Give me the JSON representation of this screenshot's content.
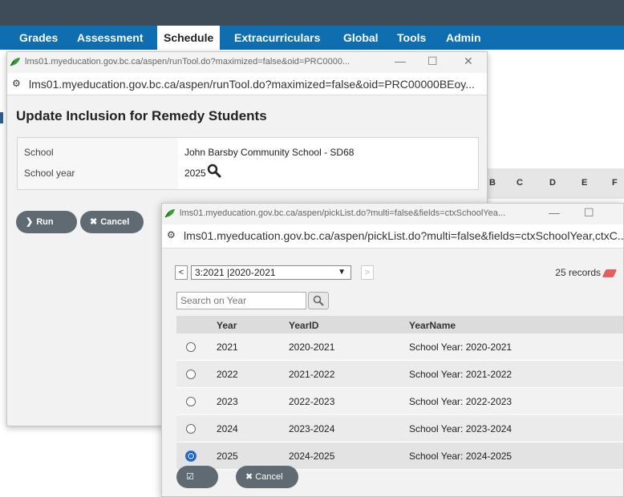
{
  "nav": {
    "tabs": [
      {
        "label": "Grades"
      },
      {
        "label": "Assessment"
      },
      {
        "label": "Schedule"
      },
      {
        "label": "Extracurriculars"
      },
      {
        "label": "Global"
      },
      {
        "label": "Tools"
      },
      {
        "label": "Admin"
      }
    ]
  },
  "background": {
    "letters": [
      "B",
      "C",
      "D",
      "E",
      "F"
    ]
  },
  "tool_window": {
    "title": "lms01.myeducation.gov.bc.ca/aspen/runTool.do?maximized=false&oid=PRC0000...",
    "url": "lms01.myeducation.gov.bc.ca/aspen/runTool.do?maximized=false&oid=PRC00000BEoy...",
    "heading": "Update Inclusion for Remedy Students",
    "fields": {
      "school_label": "School",
      "school_value": "John Barsby Community School - SD68",
      "year_label": "School year",
      "year_value": "2025"
    },
    "run_label": "Run",
    "cancel_label": "Cancel"
  },
  "picklist_window": {
    "title": "lms01.myeducation.gov.bc.ca/aspen/pickList.do?multi=false&fields=ctxSchoolYea...",
    "url": "lms01.myeducation.gov.bc.ca/aspen/pickList.do?multi=false&fields=ctxSchoolYear,ctxC...",
    "prev_label": "<",
    "next_label": ">",
    "page_select": "3:2021 |2020-2021",
    "records": "25 records",
    "search_placeholder": "Search on Year",
    "columns": [
      "Year",
      "YearID",
      "YearName"
    ],
    "rows": [
      {
        "year": "2021",
        "yearid": "2020-2021",
        "yearname": "School Year: 2020-2021",
        "selected": false
      },
      {
        "year": "2022",
        "yearid": "2021-2022",
        "yearname": "School Year: 2021-2022",
        "selected": false
      },
      {
        "year": "2023",
        "yearid": "2022-2023",
        "yearname": "School Year: 2022-2023",
        "selected": false
      },
      {
        "year": "2024",
        "yearid": "2023-2024",
        "yearname": "School Year: 2023-2024",
        "selected": false
      },
      {
        "year": "2025",
        "yearid": "2024-2025",
        "yearname": "School Year: 2024-2025",
        "selected": true
      }
    ],
    "ok_label": "OK",
    "cancel_label": "Cancel"
  },
  "colors": {
    "nav_blue": "#0e6eb0",
    "top_dark": "#3e4c59",
    "pill_gray": "#606a72",
    "radio_blue": "#1a73e8"
  }
}
